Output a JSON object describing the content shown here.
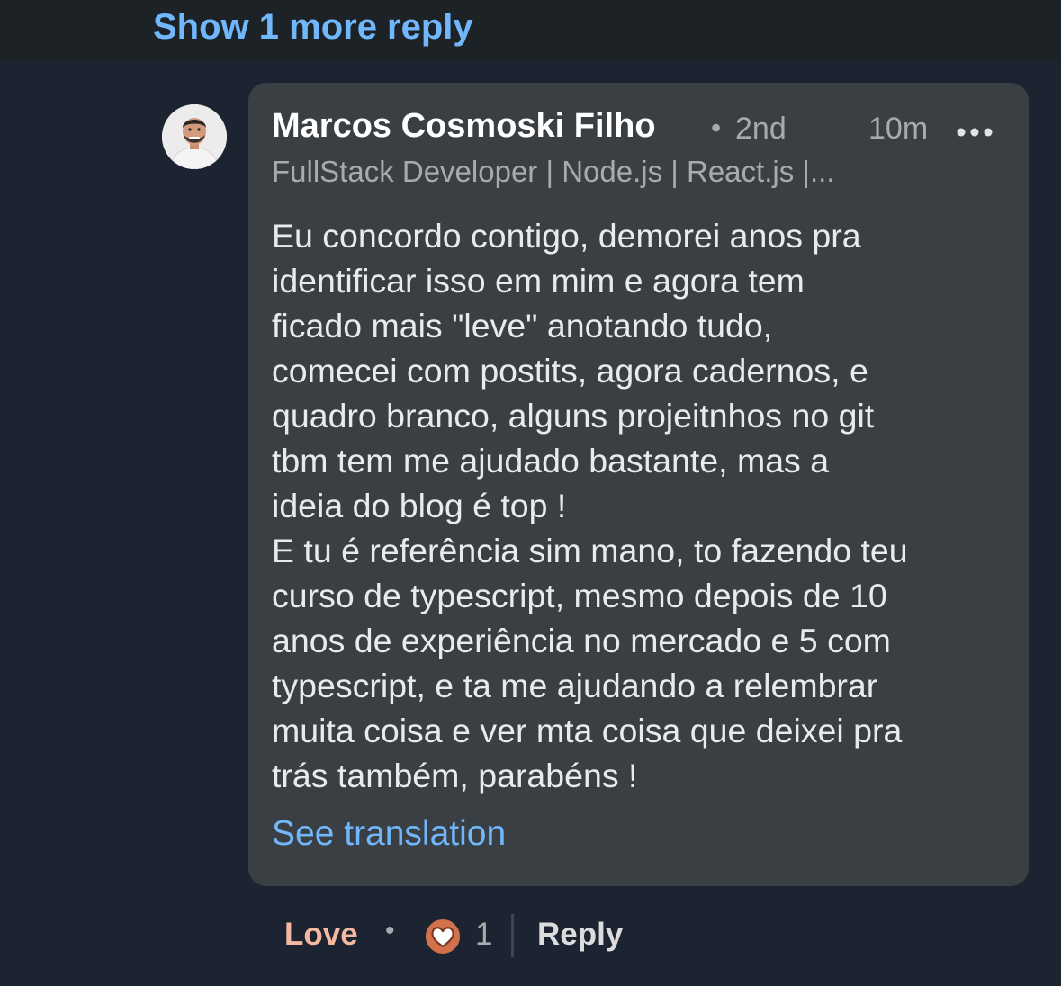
{
  "thread": {
    "show_more_label": "Show 1 more reply"
  },
  "comment": {
    "author_name": "Marcos Cosmoski Filho",
    "connection_dot": "•",
    "connection_degree": "2nd",
    "time_ago": "10m",
    "headline": "FullStack Developer | Node.js | React.js |...",
    "body": "Eu concordo contigo, demorei anos pra\nidentificar isso em mim e agora tem\nficado mais \"leve\" anotando tudo,\ncomecei com postits, agora cadernos, e\nquadro branco, alguns projeitnhos no git\ntbm tem me ajudado bastante, mas a\nideia do blog é top !\nE tu é referência sim mano, to fazendo teu\ncurso de typescript, mesmo depois de 10\nanos de experiência no mercado e 5 com\ntypescript, e ta me ajudando a relembrar\nmuita coisa e ver mta coisa que deixei pra\ntrás também, parabéns !",
    "see_translation_label": "See translation",
    "more_icon": "more-horizontal-icon",
    "avatar_icon": "profile-photo"
  },
  "actions": {
    "reaction_label": "Love",
    "separator": "•",
    "reaction_icon": "heart-reaction-icon",
    "reaction_count": "1",
    "reply_label": "Reply"
  },
  "colors": {
    "link": "#71b7fb",
    "bubble": "#3a3f44",
    "background": "#1b2430",
    "love": "#f5b8a0",
    "heart_badge": "#d3714c"
  }
}
